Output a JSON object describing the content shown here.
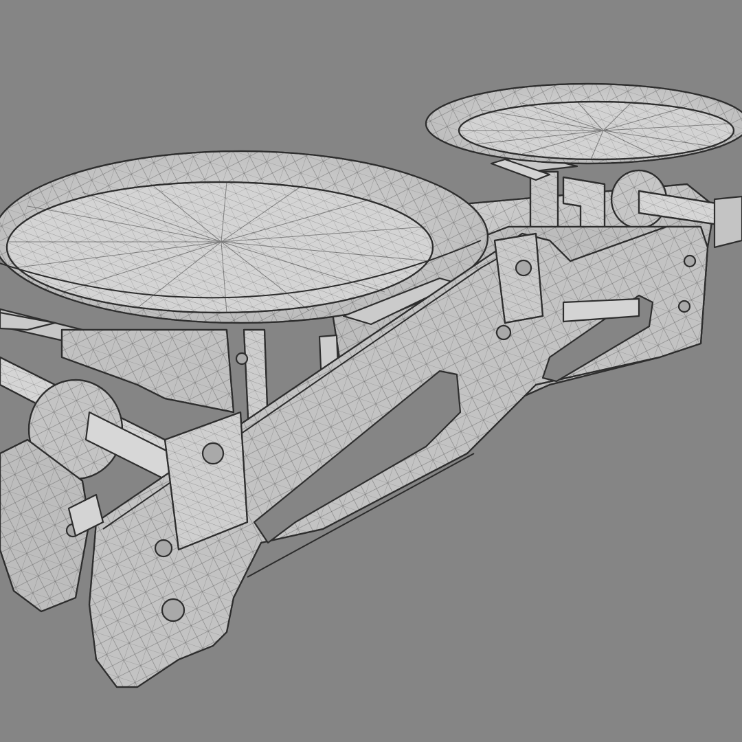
{
  "scene": {
    "subject": "balance-scale-wireframe",
    "render_style": "shaded-wireframe",
    "colors": {
      "background": "#858585",
      "surface_light": "#dcdcdc",
      "surface_mid": "#c3c3c3",
      "surface_dark": "#a6a6a6",
      "wire": "#2e2e2e"
    }
  }
}
